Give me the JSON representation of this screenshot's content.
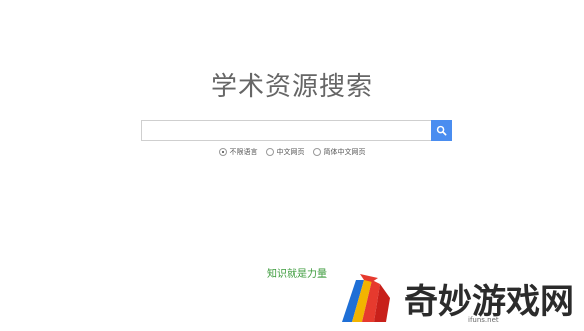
{
  "page": {
    "title": "学术资源搜索",
    "motto": "知识就是力量"
  },
  "search": {
    "value": "",
    "placeholder": "",
    "button_icon": "search-icon",
    "button_color": "#4a8df0"
  },
  "language_options": [
    {
      "label": "不限语言",
      "selected": true
    },
    {
      "label": "中文网页",
      "selected": false
    },
    {
      "label": "简体中文网页",
      "selected": false
    }
  ],
  "watermark": {
    "brand": "奇妙游戏网",
    "url": "ifuns.net"
  },
  "colors": {
    "title": "#666666",
    "motto": "#3a9a3a",
    "accent": "#4a8df0"
  }
}
